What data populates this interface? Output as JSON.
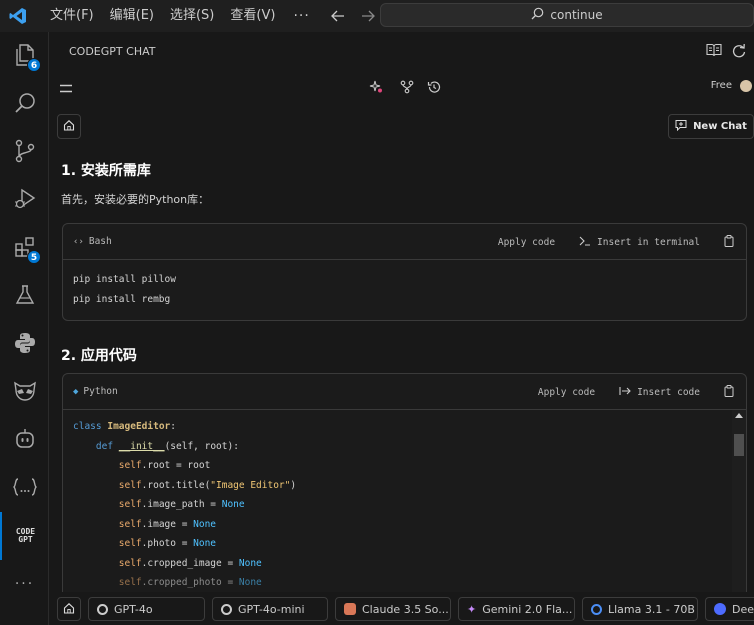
{
  "titlebar": {
    "menu": [
      "文件(F)",
      "编辑(E)",
      "选择(S)",
      "查看(V)"
    ],
    "more": "···",
    "search_text": "continue"
  },
  "activity": {
    "explorer_badge": "6",
    "extensions_badge": "5",
    "codegpt_logo_text": "CODE GPT",
    "more": "···"
  },
  "panel": {
    "title": "CODEGPT CHAT",
    "plan": "Free",
    "new_chat": "New Chat"
  },
  "content": {
    "heading1": "1. 安装所需库",
    "para1": "首先，安装必要的Python库：",
    "block1": {
      "lang": "Bash",
      "apply": "Apply code",
      "insert": "Insert in terminal",
      "lines": [
        "pip install pillow",
        "pip install rembg"
      ]
    },
    "heading2": "2. 应用代码",
    "block2": {
      "lang": "Python",
      "apply": "Apply code",
      "insert": "Insert code",
      "l1_kw": "class",
      "l1_name": "ImageEditor",
      "l1_end": ":",
      "l2_kw": "def",
      "l2_fn": "__init__",
      "l2_end": "(self, root):",
      "l3_self": "self",
      "l3_end": ".root = root",
      "l4_self": "self",
      "l4_mid": ".root.title(",
      "l4_str": "\"Image Editor\"",
      "l4_end": ")",
      "l5_self": "self",
      "l5_mid": ".image_path = ",
      "l5_none": "None",
      "l6_self": "self",
      "l6_mid": ".image = ",
      "l6_none": "None",
      "l7_self": "self",
      "l7_mid": ".photo = ",
      "l7_none": "None",
      "l8_self": "self",
      "l8_mid": ".cropped_image = ",
      "l8_none": "None",
      "l9_self": "self",
      "l9_mid": ".cropped_photo = ",
      "l9_none": "None"
    }
  },
  "models": [
    "GPT-4o",
    "GPT-4o-mini",
    "Claude 3.5 So...",
    "Gemini 2.0 Fla...",
    "Llama 3.1 - 70B",
    "Dee"
  ],
  "colors": {
    "accent": "#0078d4",
    "background": "#181818",
    "claude": "#d97757",
    "gemini": "#c58af9",
    "llama": "#0668e1",
    "deepseek": "#4d6bfe"
  }
}
